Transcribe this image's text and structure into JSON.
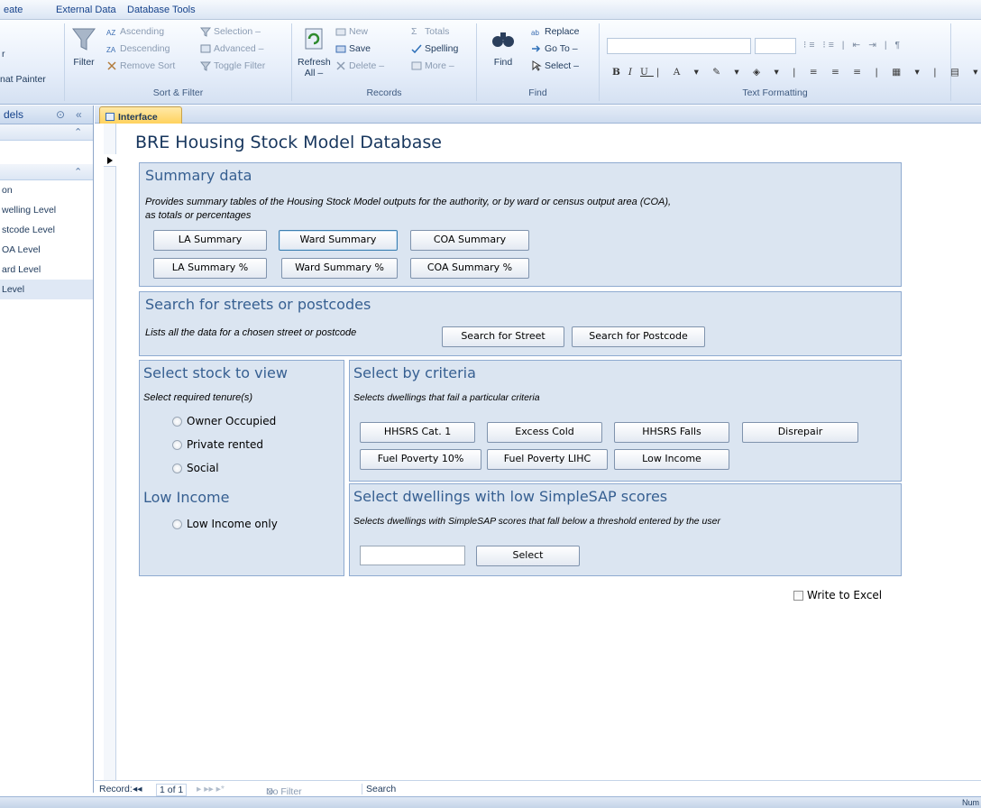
{
  "ribbon_tabs": [
    "eate",
    "External Data",
    "Database Tools"
  ],
  "ribbon": {
    "clipboard": {
      "paste_partial": "r",
      "format_painter": "nat Painter"
    },
    "sort_filter": {
      "filter": "Filter",
      "ascending": "Ascending",
      "descending": "Descending",
      "remove_sort": "Remove Sort",
      "selection": "Selection –",
      "advanced": "Advanced –",
      "toggle_filter": "Toggle Filter",
      "label": "Sort & Filter"
    },
    "records": {
      "refresh": "Refresh",
      "refresh_all": "All –",
      "new": "New",
      "save": "Save",
      "delete": "Delete –",
      "totals": "Totals",
      "spelling": "Spelling",
      "more": "More –",
      "label": "Records"
    },
    "find": {
      "find": "Find",
      "replace": "Replace",
      "goto": "Go To –",
      "select": "Select –",
      "label": "Find"
    },
    "text_formatting": {
      "label": "Text Formatting"
    }
  },
  "nav": {
    "title": "dels",
    "items": [
      "on",
      "welling Level",
      "stcode Level",
      "OA Level",
      "ard Level",
      "Level"
    ]
  },
  "doc_tab": "Interface",
  "form": {
    "title": "BRE Housing Stock Model Database",
    "summary": {
      "heading": "Summary data",
      "desc_line1": "Provides summary tables of the Housing Stock Model outputs for the authority, or by ward or census output area (COA),",
      "desc_line2": "as totals or percentages",
      "buttons": [
        "LA Summary",
        "Ward Summary",
        "COA Summary",
        "LA Summary %",
        "Ward Summary %",
        "COA Summary %"
      ]
    },
    "search": {
      "heading": "Search for streets or postcodes",
      "desc": "Lists all the data for a chosen street or postcode",
      "street_button": "Search for Street",
      "postcode_button": "Search for Postcode"
    },
    "stock": {
      "heading": "Select stock to view",
      "desc": "Select required tenure(s)",
      "options": [
        "Owner Occupied",
        "Private rented",
        "Social"
      ],
      "low_income_heading": "Low Income",
      "low_income_option": "Low Income only"
    },
    "criteria": {
      "heading": "Select by criteria",
      "desc": "Selects dwellings that fail a particular criteria",
      "buttons": [
        "HHSRS Cat. 1",
        "Excess Cold",
        "HHSRS Falls",
        "Disrepair",
        "Fuel Poverty 10%",
        "Fuel Poverty LIHC",
        "Low Income"
      ]
    },
    "simplesap": {
      "heading": "Select dwellings with low SimpleSAP scores",
      "desc": "Selects dwellings with SimpleSAP scores that fall below a threshold entered by the user",
      "input_value": "",
      "select_button": "Select"
    },
    "write_excel": "Write to Excel"
  },
  "record_nav": {
    "label": "Record:",
    "position": "1 of 1",
    "filter": "No Filter",
    "search": "Search"
  },
  "status": {
    "num": "Num"
  }
}
